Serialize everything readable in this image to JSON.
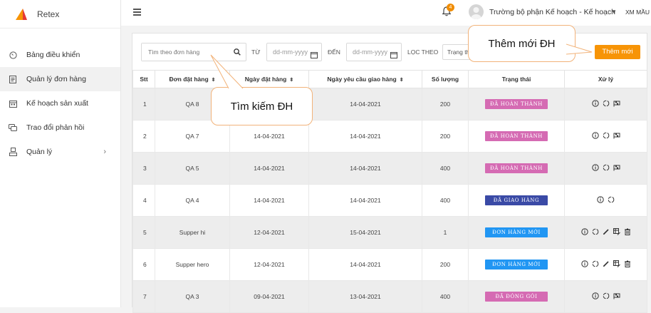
{
  "app": {
    "name": "Retex"
  },
  "sidebar": {
    "items": [
      {
        "label": "Bảng điều khiển"
      },
      {
        "label": "Quản lý đơn hàng",
        "active": true
      },
      {
        "label": "Kế hoạch sản xuất"
      },
      {
        "label": "Trao đổi phản hồi"
      },
      {
        "label": "Quản lý"
      }
    ]
  },
  "topbar": {
    "notification_count": "4",
    "user_name": "Trường bộ phận Kế hoạch - Kế hoạch",
    "user_extra": "XM MẦU"
  },
  "filters": {
    "search_placeholder": "Tìm theo đơn hàng",
    "from_label": "TỪ",
    "to_label": "ĐẾN",
    "date_placeholder": "dd-mm-yyyy",
    "filter_label": "LỌC THEO",
    "filter_value": "Trạng thái",
    "add_button": "Thêm mới"
  },
  "table": {
    "headers": [
      "Stt",
      "Đơn đặt hàng",
      "Ngày đặt hàng",
      "Ngày yêu cầu giao hàng",
      "Số lượng",
      "Trạng thái",
      "Xử lý"
    ],
    "rows": [
      {
        "stt": "1",
        "order": "QA 8",
        "order_date": "",
        "required_date": "14-04-2021",
        "qty": "200",
        "status": "ĐÃ HOÀN THÀNH"
      },
      {
        "stt": "2",
        "order": "QA 7",
        "order_date": "14-04-2021",
        "required_date": "14-04-2021",
        "qty": "200",
        "status": "ĐÃ HOÀN THÀNH"
      },
      {
        "stt": "3",
        "order": "QA 5",
        "order_date": "14-04-2021",
        "required_date": "14-04-2021",
        "qty": "400",
        "status": "ĐÃ HOÀN THÀNH"
      },
      {
        "stt": "4",
        "order": "QA 4",
        "order_date": "14-04-2021",
        "required_date": "14-04-2021",
        "qty": "400",
        "status": "ĐÃ GIAO HÀNG"
      },
      {
        "stt": "5",
        "order": "Supper hi",
        "order_date": "12-04-2021",
        "required_date": "15-04-2021",
        "qty": "1",
        "status": "ĐƠN HÀNG MỚI"
      },
      {
        "stt": "6",
        "order": "Supper hero",
        "order_date": "12-04-2021",
        "required_date": "14-04-2021",
        "qty": "200",
        "status": "ĐƠN HÀNG MỚI"
      },
      {
        "stt": "7",
        "order": "QA 3",
        "order_date": "09-04-2021",
        "required_date": "13-04-2021",
        "qty": "400",
        "status": "ĐÃ ĐÓNG GÓI"
      }
    ]
  },
  "status_colors": {
    "completed": "#d56bb3",
    "delivered": "#3a4aa6",
    "new": "#2196f3",
    "packed": "#d56bb3"
  },
  "annotations": {
    "add_callout": "Thêm mới ĐH",
    "search_callout": "Tìm kiếm ĐH"
  }
}
